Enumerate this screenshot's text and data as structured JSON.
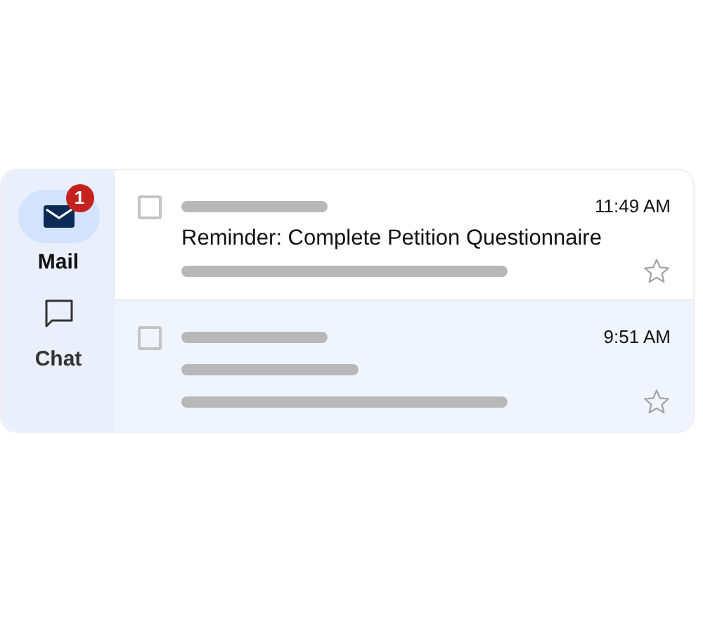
{
  "nav": [
    {
      "kind": "mail",
      "label": "Mail",
      "selected": true,
      "badge": "1"
    },
    {
      "kind": "chat",
      "label": "Chat",
      "selected": false
    }
  ],
  "messages": [
    {
      "time": "11:49 AM",
      "subject": "Reminder: Complete Petition Questionnaire",
      "checked": false,
      "starred": false,
      "highlighted": false
    },
    {
      "time": "9:51 AM",
      "checked": false,
      "starred": false,
      "highlighted": true
    }
  ]
}
